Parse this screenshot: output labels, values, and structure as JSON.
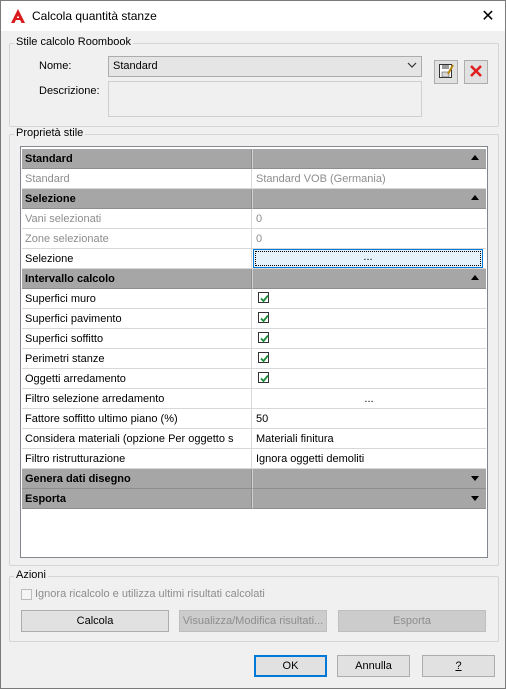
{
  "window": {
    "title": "Calcola quantità stanze",
    "close_glyph": "✕"
  },
  "style_group": {
    "legend": "Stile calcolo Roombook",
    "name_label": "Nome:",
    "name_value": "Standard",
    "description_label": "Descrizione:",
    "description_value": ""
  },
  "properties_group": {
    "legend": "Proprietà stile"
  },
  "grid": {
    "rows": [
      {
        "name": "Standard",
        "value": "",
        "type": "category",
        "expanded": true
      },
      {
        "name": "Standard",
        "value": "Standard VOB (Germania)",
        "type": "text",
        "disabled": true
      },
      {
        "name": "Selezione",
        "value": "",
        "type": "category",
        "expanded": true
      },
      {
        "name": "Vani selezionati",
        "value": "0",
        "type": "text",
        "disabled": true
      },
      {
        "name": "Zone selezionate",
        "value": "0",
        "type": "text",
        "disabled": true
      },
      {
        "name": "Selezione",
        "value": "...",
        "type": "button",
        "disabled": false
      },
      {
        "name": "Intervallo calcolo",
        "value": "",
        "type": "category",
        "expanded": true
      },
      {
        "name": "Superfici muro",
        "value": "checked",
        "type": "checkbox",
        "checked": true
      },
      {
        "name": "Superfici pavimento",
        "value": "checked",
        "type": "checkbox",
        "checked": true
      },
      {
        "name": "Superfici soffitto",
        "value": "checked",
        "type": "checkbox",
        "checked": true
      },
      {
        "name": "Perimetri stanze",
        "value": "checked",
        "type": "checkbox",
        "checked": true
      },
      {
        "name": "Oggetti arredamento",
        "value": "checked",
        "type": "checkbox",
        "checked": true
      },
      {
        "name": "Filtro selezione arredamento",
        "value": "...",
        "type": "ellipsis"
      },
      {
        "name": "Fattore soffitto ultimo piano (%)",
        "value": "50",
        "type": "text"
      },
      {
        "name": "Considera materiali (opzione Per oggetto s",
        "value": "Materiali finitura",
        "type": "text"
      },
      {
        "name": "Filtro ristrutturazione",
        "value": "Ignora oggetti demoliti",
        "type": "text"
      },
      {
        "name": "Genera dati disegno",
        "value": "",
        "type": "category",
        "expanded": false
      },
      {
        "name": "Esporta",
        "value": "",
        "type": "category",
        "expanded": false
      }
    ]
  },
  "actions_group": {
    "legend": "Azioni",
    "ignore_checkbox_label": "Ignora ricalcolo e utilizza ultimi risultati calcolati",
    "calc_button": "Calcola",
    "view_button": "Visualizza/Modifica risultati...",
    "export_button": "Esporta"
  },
  "footer": {
    "ok": "OK",
    "cancel": "Annulla",
    "help": "?"
  },
  "colors": {
    "category_bg": "#a6a6a6",
    "check_green": "#1c8c3a",
    "accent": "#0078d7",
    "delete_red": "#e02020",
    "app_icon_red": "#d9191c"
  },
  "icons": {
    "app": "autocad-a-icon",
    "save": "save-style-icon",
    "delete": "delete-x-icon",
    "close": "close-icon"
  }
}
